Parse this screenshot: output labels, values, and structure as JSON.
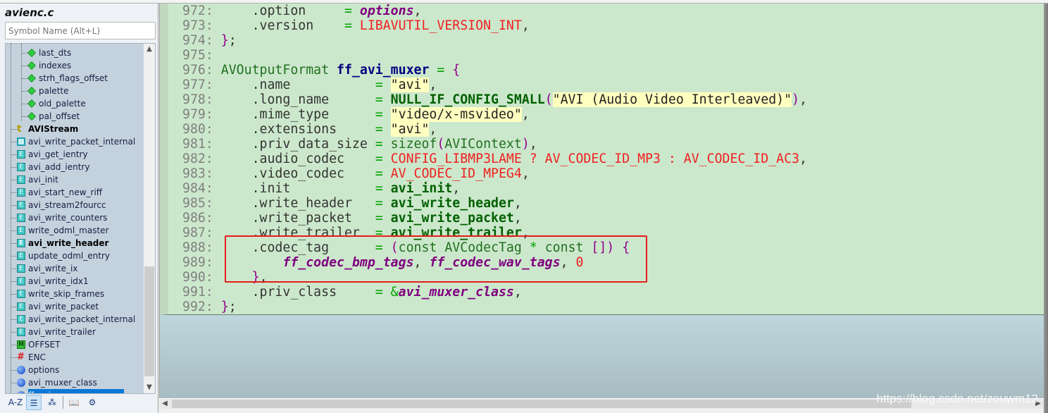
{
  "sidebar": {
    "file_title": "avienc.c",
    "search_placeholder": "Symbol Name (Alt+L)",
    "items": [
      {
        "label": "last_dts",
        "kind": "member",
        "level": 2
      },
      {
        "label": "indexes",
        "kind": "member",
        "level": 2
      },
      {
        "label": "strh_flags_offset",
        "kind": "member",
        "level": 2
      },
      {
        "label": "palette",
        "kind": "member",
        "level": 2
      },
      {
        "label": "old_palette",
        "kind": "member",
        "level": 2
      },
      {
        "label": "pal_offset",
        "kind": "member",
        "level": 2
      },
      {
        "label": "AVIStream",
        "kind": "struct",
        "level": 1,
        "bold": true
      },
      {
        "label": "avi_write_packet_internal",
        "kind": "proto",
        "level": 1
      },
      {
        "label": "avi_get_ientry",
        "kind": "func",
        "level": 1
      },
      {
        "label": "avi_add_ientry",
        "kind": "func",
        "level": 1
      },
      {
        "label": "avi_init",
        "kind": "func",
        "level": 1
      },
      {
        "label": "avi_start_new_riff",
        "kind": "func",
        "level": 1
      },
      {
        "label": "avi_stream2fourcc",
        "kind": "func",
        "level": 1
      },
      {
        "label": "avi_write_counters",
        "kind": "func",
        "level": 1
      },
      {
        "label": "write_odml_master",
        "kind": "func",
        "level": 1
      },
      {
        "label": "avi_write_header",
        "kind": "func",
        "level": 1,
        "bold": true
      },
      {
        "label": "update_odml_entry",
        "kind": "func",
        "level": 1
      },
      {
        "label": "avi_write_ix",
        "kind": "func",
        "level": 1
      },
      {
        "label": "avi_write_idx1",
        "kind": "func",
        "level": 1
      },
      {
        "label": "write_skip_frames",
        "kind": "func",
        "level": 1
      },
      {
        "label": "avi_write_packet",
        "kind": "func",
        "level": 1
      },
      {
        "label": "avi_write_packet_internal",
        "kind": "func",
        "level": 1
      },
      {
        "label": "avi_write_trailer",
        "kind": "func",
        "level": 1
      },
      {
        "label": "OFFSET",
        "kind": "macro",
        "level": 1
      },
      {
        "label": "ENC",
        "kind": "define",
        "level": 1
      },
      {
        "label": "options",
        "kind": "var",
        "level": 1
      },
      {
        "label": "avi_muxer_class",
        "kind": "var",
        "level": 1
      },
      {
        "label": "ff_avi_muxer",
        "kind": "var",
        "level": 1,
        "selected": true
      }
    ],
    "toolbar": [
      {
        "name": "sort-az-button",
        "icon": "A-Z"
      },
      {
        "name": "list-view-button",
        "icon": "☰",
        "active": true
      },
      {
        "name": "symbol-types-button",
        "icon": "⁂"
      },
      {
        "name": "book-button",
        "icon": "📖"
      },
      {
        "name": "settings-button",
        "icon": "⚙"
      }
    ]
  },
  "code": {
    "lines": [
      {
        "n": "972",
        "tokens": [
          [
            "field",
            "    .option     "
          ],
          [
            "op",
            "= "
          ],
          [
            "var",
            "options"
          ],
          [
            "punc",
            ","
          ]
        ]
      },
      {
        "n": "973",
        "tokens": [
          [
            "field",
            "    .version    "
          ],
          [
            "op",
            "= "
          ],
          [
            "macro",
            "LIBAVUTIL_VERSION_INT"
          ],
          [
            "punc",
            ","
          ]
        ]
      },
      {
        "n": "974",
        "tokens": [
          [
            "brace",
            "}"
          ],
          [
            "punc",
            ";"
          ]
        ]
      },
      {
        "n": "975",
        "tokens": []
      },
      {
        "n": "976",
        "tokens": [
          [
            "type",
            "AVOutputFormat "
          ],
          [
            "decl",
            "ff_avi_muxer"
          ],
          [
            "punc",
            " "
          ],
          [
            "op",
            "= "
          ],
          [
            "brace",
            "{"
          ]
        ]
      },
      {
        "n": "977",
        "tokens": [
          [
            "field",
            "    .name           "
          ],
          [
            "op",
            "= "
          ],
          [
            "str",
            "\"avi\""
          ],
          [
            "punc",
            ","
          ]
        ]
      },
      {
        "n": "978",
        "tokens": [
          [
            "field",
            "    .long_name      "
          ],
          [
            "op",
            "= "
          ],
          [
            "func",
            "NULL_IF_CONFIG_SMALL"
          ],
          [
            "brace",
            "("
          ],
          [
            "str",
            "\"AVI (Audio Video Interleaved)\""
          ],
          [
            "brace",
            ")"
          ],
          [
            "punc",
            ","
          ]
        ]
      },
      {
        "n": "979",
        "tokens": [
          [
            "field",
            "    .mime_type      "
          ],
          [
            "op",
            "= "
          ],
          [
            "str",
            "\"video/x-msvideo\""
          ],
          [
            "punc",
            ","
          ]
        ]
      },
      {
        "n": "980",
        "tokens": [
          [
            "field",
            "    .extensions     "
          ],
          [
            "op",
            "= "
          ],
          [
            "str",
            "\"avi\""
          ],
          [
            "punc",
            ","
          ]
        ]
      },
      {
        "n": "981",
        "tokens": [
          [
            "field",
            "    .priv_data_size "
          ],
          [
            "op",
            "= "
          ],
          [
            "type",
            "sizeof"
          ],
          [
            "brace",
            "("
          ],
          [
            "type",
            "AVIContext"
          ],
          [
            "brace",
            ")"
          ],
          [
            "punc",
            ","
          ]
        ]
      },
      {
        "n": "982",
        "tokens": [
          [
            "field",
            "    .audio_codec    "
          ],
          [
            "op",
            "= "
          ],
          [
            "macro",
            "CONFIG_LIBMP3LAME ? AV_CODEC_ID_MP3 : AV_CODEC_ID_AC3"
          ],
          [
            "punc",
            ","
          ]
        ]
      },
      {
        "n": "983",
        "tokens": [
          [
            "field",
            "    .video_codec    "
          ],
          [
            "op",
            "= "
          ],
          [
            "macro",
            "AV_CODEC_ID_MPEG4"
          ],
          [
            "punc",
            ","
          ]
        ]
      },
      {
        "n": "984",
        "tokens": [
          [
            "field",
            "    .init           "
          ],
          [
            "op",
            "= "
          ],
          [
            "func",
            "avi_init"
          ],
          [
            "punc",
            ","
          ]
        ]
      },
      {
        "n": "985",
        "tokens": [
          [
            "field",
            "    .write_header   "
          ],
          [
            "op",
            "= "
          ],
          [
            "func",
            "avi_write_header"
          ],
          [
            "punc",
            ","
          ]
        ]
      },
      {
        "n": "986",
        "tokens": [
          [
            "field",
            "    .write_packet   "
          ],
          [
            "op",
            "= "
          ],
          [
            "func",
            "avi_write_packet"
          ],
          [
            "punc",
            ","
          ]
        ]
      },
      {
        "n": "987",
        "tokens": [
          [
            "field",
            "    .write_trailer  "
          ],
          [
            "op",
            "= "
          ],
          [
            "func",
            "avi_write_trailer"
          ],
          [
            "punc",
            ","
          ]
        ]
      },
      {
        "n": "988",
        "tokens": [
          [
            "field",
            "    .codec_tag      "
          ],
          [
            "op",
            "= "
          ],
          [
            "brace",
            "("
          ],
          [
            "type",
            "const AVCodecTag "
          ],
          [
            "op",
            "* "
          ],
          [
            "type",
            "const "
          ],
          [
            "brace",
            "[])"
          ],
          [
            "punc",
            " "
          ],
          [
            "brace",
            "{"
          ]
        ]
      },
      {
        "n": "989",
        "tokens": [
          [
            "punc",
            "        "
          ],
          [
            "var",
            "ff_codec_bmp_tags"
          ],
          [
            "punc",
            ", "
          ],
          [
            "var",
            "ff_codec_wav_tags"
          ],
          [
            "punc",
            ", "
          ],
          [
            "num",
            "0"
          ]
        ]
      },
      {
        "n": "990",
        "tokens": [
          [
            "punc",
            "    "
          ],
          [
            "brace",
            "}"
          ],
          [
            "punc",
            ","
          ]
        ]
      },
      {
        "n": "991",
        "tokens": [
          [
            "field",
            "    .priv_class     "
          ],
          [
            "op",
            "= &"
          ],
          [
            "var",
            "avi_muxer_class"
          ],
          [
            "punc",
            ","
          ]
        ]
      },
      {
        "n": "992",
        "tokens": [
          [
            "brace",
            "}"
          ],
          [
            "punc",
            ";"
          ]
        ]
      }
    ]
  },
  "watermark": "https://blog.csdn.net/zouwm12",
  "colors": {
    "editor_bg": "#cce8cc",
    "highlight_box": "#e81c1c",
    "selection": "#0a78d7"
  }
}
